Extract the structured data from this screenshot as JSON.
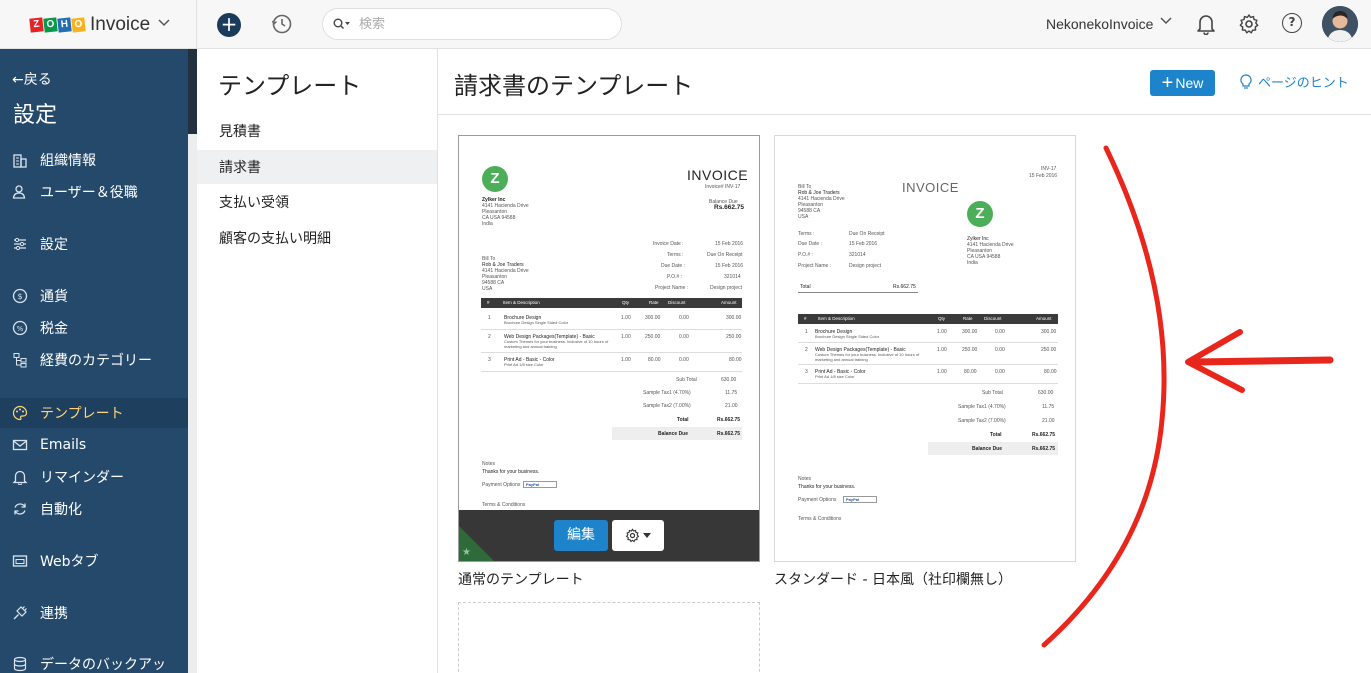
{
  "topbar": {
    "app_name": "Invoice",
    "search_placeholder": "検索",
    "org_name": "NekonekoInvoice"
  },
  "sidebar": {
    "back": "←戻る",
    "title": "設定",
    "items": [
      {
        "label": "組織情報",
        "icon": "building-icon"
      },
      {
        "label": "ユーザー＆役職",
        "icon": "users-icon"
      },
      {
        "label": "設定",
        "icon": "sliders-icon"
      },
      {
        "label": "通貨",
        "icon": "currency-icon"
      },
      {
        "label": "税金",
        "icon": "percent-icon"
      },
      {
        "label": "経費のカテゴリー",
        "icon": "tree-icon"
      },
      {
        "label": "テンプレート",
        "icon": "palette-icon"
      },
      {
        "label": "Emails",
        "icon": "mail-icon"
      },
      {
        "label": "リマインダー",
        "icon": "bell-icon"
      },
      {
        "label": "自動化",
        "icon": "sync-icon"
      },
      {
        "label": "Webタブ",
        "icon": "window-icon"
      },
      {
        "label": "連携",
        "icon": "plug-icon"
      },
      {
        "label": "データのバックアッ",
        "icon": "database-icon"
      }
    ]
  },
  "subnav": {
    "title": "テンプレート",
    "items": [
      "見積書",
      "請求書",
      "支払い受領",
      "顧客の支払い明細"
    ]
  },
  "main": {
    "title": "請求書のテンプレート",
    "new_label": "New",
    "hint_label": "ページのヒント",
    "edit_label": "編集"
  },
  "templates": [
    {
      "caption": "通常のテンプレート",
      "invoice_title": "INVOICE",
      "invoice_no": "Invoice# INV-17",
      "balance_due_label": "Balance Due",
      "balance_due": "Rs.662.75",
      "company": [
        "Zylker Inc",
        "4141 Hacienda Drive",
        "Pleasanton",
        "CA USA 94588",
        "India"
      ],
      "bill_to": [
        "Bill To",
        "Rob & Joe Traders",
        "4141 Hacienda Drive",
        "Pleasanton",
        "94588 CA",
        "USA"
      ],
      "meta": [
        [
          "Invoice Date :",
          "15 Feb 2016"
        ],
        [
          "Terms :",
          "Due On Receipt"
        ],
        [
          "Due Date :",
          "15 Feb 2016"
        ],
        [
          "P.O.# :",
          "321014"
        ],
        [
          "Project Name :",
          "Design project"
        ]
      ],
      "columns": [
        "#",
        "Item & Description",
        "Qty",
        "Rate",
        "Discount",
        "Amount"
      ],
      "rows": [
        [
          "1",
          "Brochure Design",
          "Brochure Design Single Sided Color",
          "1.00",
          "300.00",
          "0.00",
          "300.00"
        ],
        [
          "2",
          "Web Design Packages(Template) - Basic",
          "Custom Themes for your business. Inclusive of 10 hours of marketing and annual training",
          "1.00",
          "250.00",
          "0.00",
          "250.00"
        ],
        [
          "3",
          "Print Ad - Basic - Color",
          "Print Ad 1/8 size Color",
          "1.00",
          "80.00",
          "0.00",
          "80.00"
        ]
      ],
      "totals": [
        [
          "Sub Total",
          "630.00"
        ],
        [
          "Sample Tax1 (4.70%)",
          "11.75"
        ],
        [
          "Sample Tax2 (7.00%)",
          "21.00"
        ],
        [
          "Total",
          "Rs.662.75"
        ],
        [
          "Balance Due",
          "Rs.662.75"
        ]
      ],
      "notes_label": "Notes",
      "notes": "Thanks for your business.",
      "payment_label": "Payment Options",
      "terms_label": "Terms & Conditions",
      "paypal": "PayPal"
    },
    {
      "caption": "スタンダード - 日本風（社印欄無し）",
      "invoice_title": "INVOICE",
      "invoice_no": "INV-17",
      "date": "15 Feb 2016",
      "bill_to": [
        "Bill To",
        "Rob & Joe Traders",
        "4141 Hacienda Drive",
        "Pleasanton",
        "94588 CA",
        "USA"
      ],
      "company": [
        "Zylker Inc",
        "4141 Hacienda Drive",
        "Pleasanton",
        "CA USA 94588",
        "India"
      ],
      "meta": [
        [
          "Terms :",
          "Due On Receipt"
        ],
        [
          "Due Date :",
          "15 Feb 2016"
        ],
        [
          "P.O.# :",
          "321014"
        ],
        [
          "Project Name :",
          "Design project"
        ]
      ],
      "total_label": "Total",
      "total": "Rs.662.75",
      "columns": [
        "#",
        "Item & Description",
        "Qty",
        "Rate",
        "Discount",
        "Amount"
      ],
      "rows": [
        [
          "1",
          "Brochure Design",
          "Brochure Design Single Sided Color",
          "1.00",
          "300.00",
          "0.00",
          "300.00"
        ],
        [
          "2",
          "Web Design Packages(Template) - Basic",
          "Custom Themes for your business. Inclusive of 10 hours of marketing and annual training",
          "1.00",
          "250.00",
          "0.00",
          "250.00"
        ],
        [
          "3",
          "Print Ad - Basic - Color",
          "Print Ad 1/8 size Color",
          "1.00",
          "80.00",
          "0.00",
          "80.00"
        ]
      ],
      "totals": [
        [
          "Sub Total",
          "630.00"
        ],
        [
          "Sample Tax1 (4.70%)",
          "11.75"
        ],
        [
          "Sample Tax2 (7.00%)",
          "21.00"
        ],
        [
          "Total",
          "Rs.662.75"
        ],
        [
          "Balance Due",
          "Rs.662.75"
        ]
      ],
      "notes_label": "Notes",
      "notes": "Thanks for your business.",
      "payment_label": "Payment Options",
      "terms_label": "Terms & Conditions",
      "paypal": "PayPal"
    }
  ],
  "colors": {
    "sidebar_bg": "#24496b",
    "active_text": "#ffd57a",
    "accent": "#1d84cc",
    "annotation": "#e8261b"
  }
}
